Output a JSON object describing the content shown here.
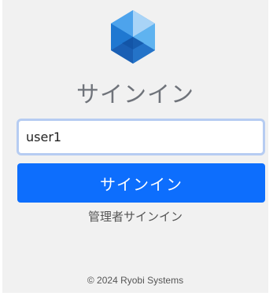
{
  "logo": {
    "icon": "cube-logo-icon",
    "colors": [
      "#1a5fb4",
      "#2d8ae0",
      "#5fb3f0",
      "#a9d4f7"
    ]
  },
  "title": "サインイン",
  "username": {
    "value": "user1"
  },
  "signin_button": {
    "label": "サインイン",
    "color": "#0d6efd"
  },
  "admin_link": {
    "label": "管理者サインイン"
  },
  "footer": {
    "copyright": "© 2024 Ryobi Systems"
  }
}
